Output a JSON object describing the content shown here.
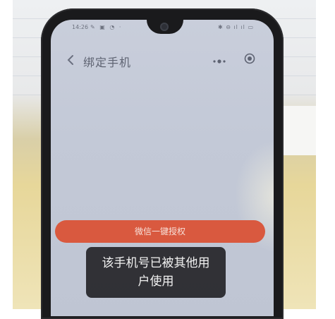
{
  "status_bar": {
    "time": "14:26",
    "left_icons": "✎ ▣ ◔ ·",
    "right_icons": "✱ ⊖ ıl ıl ▭"
  },
  "nav": {
    "title": "绑定手机",
    "back_icon": "chevron-left",
    "more_icon": "more-dots",
    "record_icon": "record-circle"
  },
  "auth_button": {
    "label": "微信一键授权",
    "color": "#d9593f"
  },
  "toast": {
    "message": "该手机号已被其他用户使用"
  }
}
